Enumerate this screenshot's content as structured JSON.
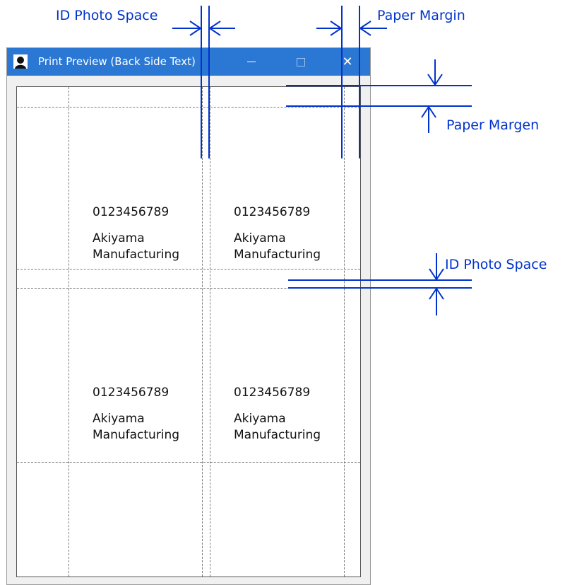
{
  "window": {
    "title": "Print Preview (Back Side Text)",
    "icon": "id-photo-person-icon",
    "minimize_label": "—",
    "maximize_label": "",
    "close_label": "✕",
    "titlebar_color": "#2b78d4"
  },
  "cards": [
    {
      "number": "0123456789",
      "name": "Akiyama Manufacturing"
    },
    {
      "number": "0123456789",
      "name": "Akiyama Manufacturing"
    },
    {
      "number": "0123456789",
      "name": "Akiyama Manufacturing"
    },
    {
      "number": "0123456789",
      "name": "Akiyama Manufacturing"
    }
  ],
  "annotations": {
    "id_photo_space_top": "ID Photo Space",
    "paper_margin_top": "Paper Margin",
    "paper_margen_right": "Paper Margen",
    "id_photo_space_right": "ID Photo Space",
    "color": "#0033cc"
  }
}
